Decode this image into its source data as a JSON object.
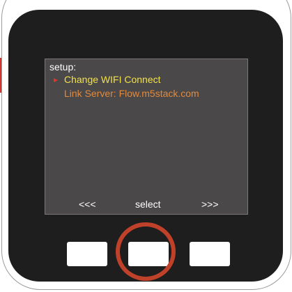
{
  "screen": {
    "title": "setup:",
    "menu_items": [
      {
        "label": "Change WIFI Connect",
        "selected": true
      },
      {
        "label": "Link Server: Flow.m5stack.com",
        "selected": false
      }
    ],
    "cursor_glyph": "►",
    "softkeys": {
      "left": "<<<",
      "middle": "select",
      "right": ">>>"
    }
  },
  "hardware_buttons": [
    "button-a",
    "button-b",
    "button-c"
  ],
  "highlighted_button": "button-b",
  "colors": {
    "device_face": "#1e1e1e",
    "screen_background": "#4a4848",
    "selected_item": "#f2e24a",
    "normal_item": "#e28a3e",
    "cursor": "#e0362e",
    "highlight_ring": "#c0412a",
    "side_tab": "#d8312e"
  }
}
